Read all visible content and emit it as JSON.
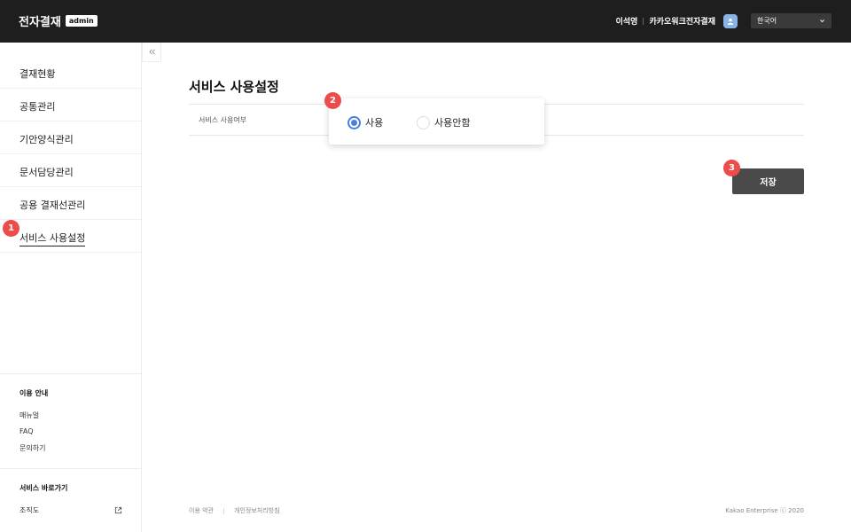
{
  "header": {
    "title": "전자결재",
    "badge": "admin",
    "user_name": "이석영",
    "org_name": "카카오워크전자결재",
    "language": "한국어"
  },
  "sidebar": {
    "items": [
      {
        "label": "결재현황"
      },
      {
        "label": "공통관리"
      },
      {
        "label": "기안양식관리"
      },
      {
        "label": "문서담당관리"
      },
      {
        "label": "공용 결재선관리"
      },
      {
        "label": "서비스 사용설정"
      }
    ],
    "guide": {
      "heading": "이용 안내",
      "links": [
        "매뉴얼",
        "FAQ",
        "문의하기"
      ]
    },
    "shortcut": {
      "heading": "서비스 바로가기",
      "links": [
        "조직도"
      ]
    }
  },
  "main": {
    "title": "서비스 사용설정",
    "field_label": "서비스 사용여부",
    "options": [
      "사용",
      "사용안함"
    ],
    "selected": "사용",
    "save_label": "저장"
  },
  "annotations": [
    "1",
    "2",
    "3"
  ],
  "footer": {
    "links": [
      "이용 약관",
      "개인정보처리방침"
    ],
    "copyright": "Kakao Enterprise ⓒ 2020"
  },
  "colors": {
    "header_bg": "#1e1e1e",
    "accent": "#4a7fe0",
    "badge": "#ee4b4b",
    "button": "#4a4a4a"
  }
}
